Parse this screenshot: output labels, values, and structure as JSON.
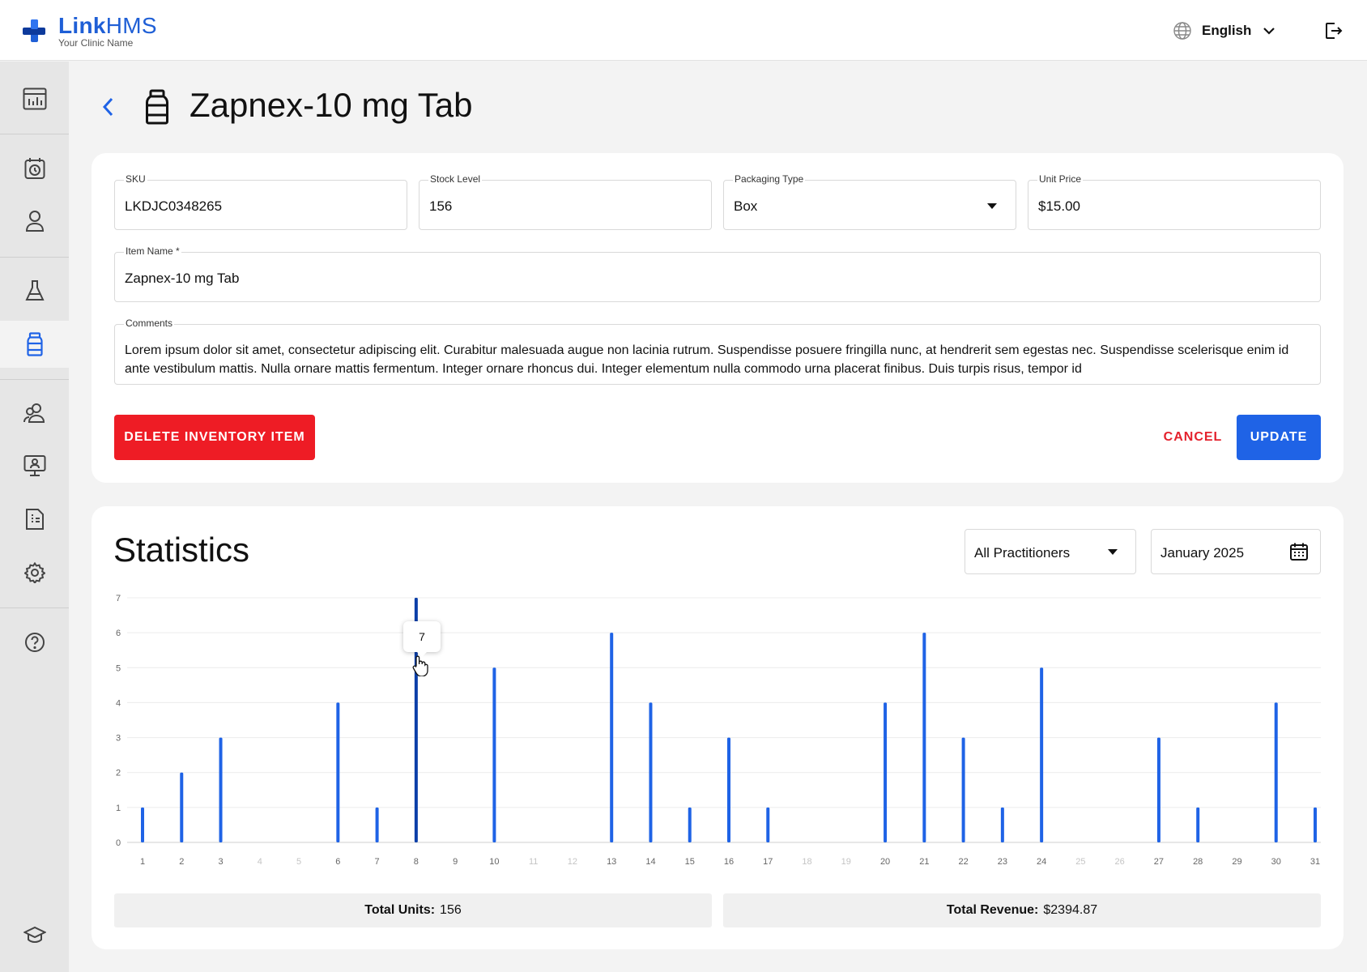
{
  "header": {
    "logo_title_bold": "Link",
    "logo_title_rest": "HMS",
    "logo_subtitle": "Your Clinic Name",
    "language": "English"
  },
  "sidebar": {
    "items": [
      {
        "name": "dashboard",
        "icon": "chart-board-icon"
      },
      {
        "name": "appointments",
        "icon": "calendar-clock-icon"
      },
      {
        "name": "patients",
        "icon": "person-icon"
      },
      {
        "name": "lab",
        "icon": "flask-icon"
      },
      {
        "name": "inventory",
        "icon": "medicine-bottle-icon",
        "active": true
      },
      {
        "name": "staff",
        "icon": "users-icon"
      },
      {
        "name": "practitioners",
        "icon": "monitor-person-icon"
      },
      {
        "name": "billing",
        "icon": "invoice-icon"
      },
      {
        "name": "settings",
        "icon": "gear-icon"
      },
      {
        "name": "help",
        "icon": "help-icon"
      },
      {
        "name": "learning",
        "icon": "graduation-cap-icon"
      }
    ]
  },
  "page": {
    "title": "Zapnex-10 mg Tab"
  },
  "form": {
    "sku_label": "SKU",
    "sku_value": "LKDJC0348265",
    "stock_label": "Stock Level",
    "stock_value": "156",
    "packaging_label": "Packaging Type",
    "packaging_value": "Box",
    "price_label": "Unit Price",
    "price_value": "$15.00",
    "item_name_label": "Item Name *",
    "item_name_value": "Zapnex-10 mg Tab",
    "comments_label": "Comments",
    "comments_value": "Lorem ipsum dolor sit amet, consectetur adipiscing elit. Curabitur malesuada augue non lacinia rutrum. Suspendisse posuere fringilla nunc, at hendrerit sem egestas nec. Suspendisse scelerisque enim id ante vestibulum mattis. Nulla ornare mattis fermentum. Integer ornare rhoncus dui. Integer elementum nulla commodo urna placerat finibus. Duis turpis risus, tempor id",
    "delete_label": "DELETE INVENTORY ITEM",
    "cancel_label": "CANCEL",
    "update_label": "UPDATE"
  },
  "stats": {
    "title": "Statistics",
    "practitioner_filter": "All Practitioners",
    "month_filter": "January 2025",
    "tooltip_value": "7",
    "total_units_label": "Total Units:",
    "total_units_value": "156",
    "total_revenue_label": "Total Revenue:",
    "total_revenue_value": "$2394.87"
  },
  "colors": {
    "accent": "#1f63e6",
    "danger": "#ee1c25",
    "bar": "#1f63e6",
    "bar_highlight": "#0b3fa8"
  },
  "chart_data": {
    "type": "bar",
    "categories": [
      "1",
      "2",
      "3",
      "4",
      "5",
      "6",
      "7",
      "8",
      "9",
      "10",
      "11",
      "12",
      "13",
      "14",
      "15",
      "16",
      "17",
      "18",
      "19",
      "20",
      "21",
      "22",
      "23",
      "24",
      "25",
      "26",
      "27",
      "28",
      "29",
      "30",
      "31"
    ],
    "values": [
      1,
      2,
      3,
      0,
      0,
      4,
      1,
      7,
      0,
      5,
      0,
      0,
      6,
      4,
      1,
      3,
      1,
      0,
      0,
      4,
      6,
      3,
      1,
      5,
      0,
      0,
      3,
      1,
      0,
      4,
      1
    ],
    "yticks": [
      "0",
      "1",
      "2",
      "3",
      "4",
      "5",
      "6",
      "7"
    ],
    "ylim": [
      0,
      7
    ],
    "grid": true,
    "highlighted_category": "8",
    "title": "",
    "xlabel": "",
    "ylabel": ""
  }
}
